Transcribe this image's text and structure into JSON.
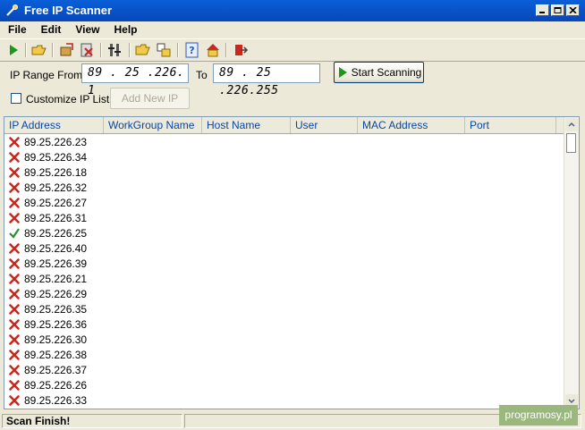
{
  "window": {
    "title": "Free IP Scanner"
  },
  "menu": [
    "File",
    "Edit",
    "View",
    "Help"
  ],
  "toolbar": {
    "icons": [
      "play-icon",
      "open-icon",
      "export-icon",
      "delete-icon",
      "settings-icon",
      "folder-icon",
      "save-icon",
      "help-icon",
      "home-icon",
      "exit-icon"
    ]
  },
  "range": {
    "from_label": "IP Range From",
    "from_value": "89 . 25 .226. 1",
    "to_label": "To",
    "to_value": "89 . 25 .226.255",
    "start_button": "Start Scanning"
  },
  "customize": {
    "label": "Customize IP List",
    "checked": false,
    "add_button": "Add New IP"
  },
  "columns": [
    "IP Address",
    "WorkGroup Name",
    "Host Name",
    "User",
    "MAC Address",
    "Port"
  ],
  "rows": [
    {
      "ip": "89.25.226.23",
      "status": "down"
    },
    {
      "ip": "89.25.226.34",
      "status": "down"
    },
    {
      "ip": "89.25.226.18",
      "status": "down"
    },
    {
      "ip": "89.25.226.32",
      "status": "down"
    },
    {
      "ip": "89.25.226.27",
      "status": "down"
    },
    {
      "ip": "89.25.226.31",
      "status": "down"
    },
    {
      "ip": "89.25.226.25",
      "status": "up"
    },
    {
      "ip": "89.25.226.40",
      "status": "down"
    },
    {
      "ip": "89.25.226.39",
      "status": "down"
    },
    {
      "ip": "89.25.226.21",
      "status": "down"
    },
    {
      "ip": "89.25.226.29",
      "status": "down"
    },
    {
      "ip": "89.25.226.35",
      "status": "down"
    },
    {
      "ip": "89.25.226.36",
      "status": "down"
    },
    {
      "ip": "89.25.226.30",
      "status": "down"
    },
    {
      "ip": "89.25.226.38",
      "status": "down"
    },
    {
      "ip": "89.25.226.37",
      "status": "down"
    },
    {
      "ip": "89.25.226.26",
      "status": "down"
    },
    {
      "ip": "89.25.226.33",
      "status": "down"
    }
  ],
  "status": {
    "text": "Scan Finish!"
  },
  "watermark": "programosy.pl",
  "colors": {
    "title_bar": "#0a5fd8",
    "down": "#c8281e",
    "up": "#2e8b2e",
    "header_text": "#0846a8"
  }
}
